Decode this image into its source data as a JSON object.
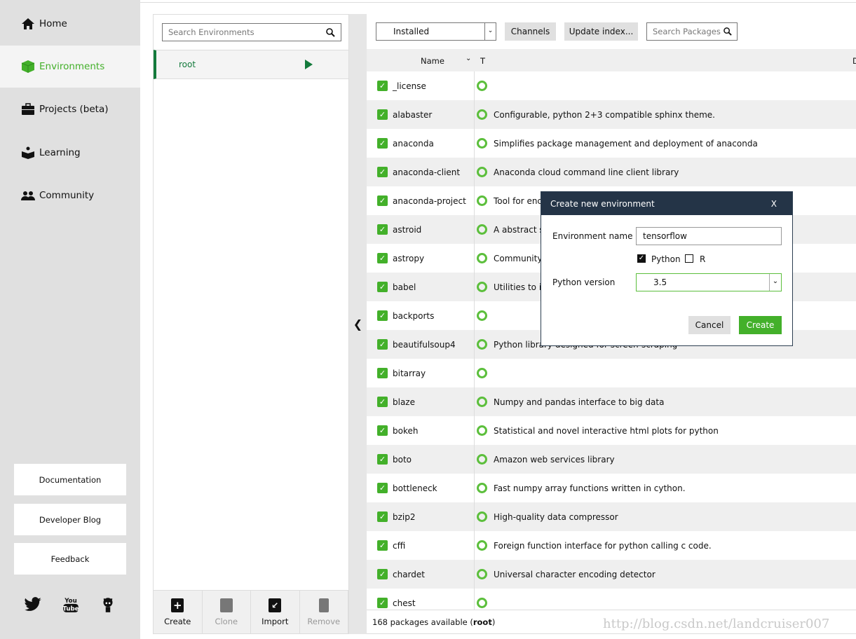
{
  "sidebar": {
    "items": [
      {
        "label": "Home",
        "icon": "home-icon"
      },
      {
        "label": "Environments",
        "icon": "cube-icon",
        "active": true
      },
      {
        "label": "Projects (beta)",
        "icon": "briefcase-icon"
      },
      {
        "label": "Learning",
        "icon": "book-reader-icon"
      },
      {
        "label": "Community",
        "icon": "people-icon"
      }
    ],
    "links": [
      "Documentation",
      "Developer Blog",
      "Feedback"
    ],
    "social": [
      "twitter-icon",
      "youtube-icon",
      "github-icon"
    ],
    "accent": "#43b02a"
  },
  "environments": {
    "search_placeholder": "Search Environments",
    "items": [
      {
        "name": "root",
        "active": true
      }
    ],
    "actions": [
      {
        "label": "Create",
        "enabled": true
      },
      {
        "label": "Clone",
        "enabled": false
      },
      {
        "label": "Import",
        "enabled": true
      },
      {
        "label": "Remove",
        "enabled": false
      }
    ]
  },
  "packages": {
    "filter": "Installed",
    "channels_label": "Channels",
    "update_label": "Update index...",
    "search_placeholder": "Search Packages",
    "columns": {
      "name": "Name",
      "type": "T",
      "description": "D"
    },
    "rows": [
      {
        "name": "_license",
        "desc": ""
      },
      {
        "name": "alabaster",
        "desc": "Configurable, python 2+3 compatible sphinx theme."
      },
      {
        "name": "anaconda",
        "desc": "Simplifies package management and deployment of anaconda"
      },
      {
        "name": "anaconda-client",
        "desc": "Anaconda cloud command line client library"
      },
      {
        "name": "anaconda-project",
        "desc": "Tool for enc"
      },
      {
        "name": "astroid",
        "desc": "A abstract s"
      },
      {
        "name": "astropy",
        "desc": "Community-"
      },
      {
        "name": "babel",
        "desc": "Utilities to i"
      },
      {
        "name": "backports",
        "desc": ""
      },
      {
        "name": "beautifulsoup4",
        "desc": "Python library designed for screen-scraping"
      },
      {
        "name": "bitarray",
        "desc": ""
      },
      {
        "name": "blaze",
        "desc": "Numpy and pandas interface to big data"
      },
      {
        "name": "bokeh",
        "desc": "Statistical and novel interactive html plots for python"
      },
      {
        "name": "boto",
        "desc": "Amazon web services library"
      },
      {
        "name": "bottleneck",
        "desc": "Fast numpy array functions written in cython."
      },
      {
        "name": "bzip2",
        "desc": "High-quality data compressor"
      },
      {
        "name": "cffi",
        "desc": "Foreign function interface for python calling c code."
      },
      {
        "name": "chardet",
        "desc": "Universal character encoding detector"
      },
      {
        "name": "chest",
        "desc": ""
      }
    ],
    "footer_prefix": "168 packages available (",
    "footer_env": "root",
    "footer_suffix": ")"
  },
  "dialog": {
    "title": "Create new environment",
    "close": "X",
    "name_label": "Environment name",
    "name_value": "tensorflow",
    "python_label": "Python",
    "python_checked": true,
    "r_label": "R",
    "r_checked": false,
    "version_label": "Python version",
    "version_value": "3.5",
    "cancel": "Cancel",
    "create": "Create"
  },
  "watermark": "http://blog.csdn.net/landcruiser007"
}
